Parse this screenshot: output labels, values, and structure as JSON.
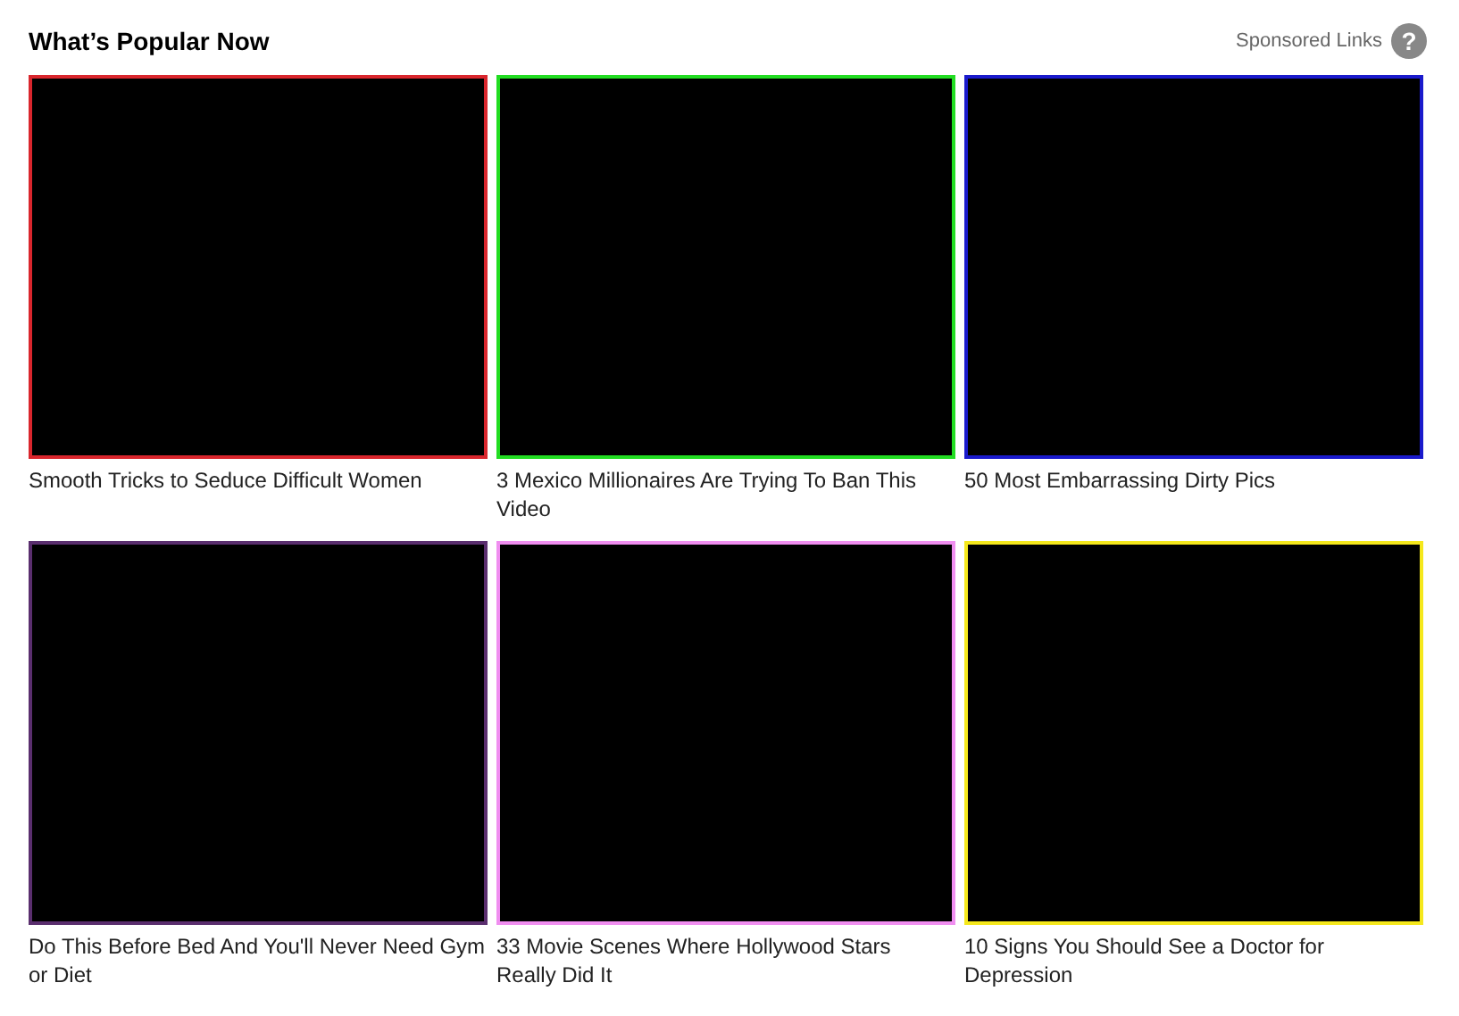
{
  "header": {
    "title": "What’s Popular Now",
    "sponsored_label": "Sponsored Links",
    "help_icon": "?"
  },
  "items": [
    {
      "caption": "Smooth Tricks to Seduce Difficult Women",
      "color": "#d9262d"
    },
    {
      "caption": "3 Mexico Millionaires Are Trying To Ban This Video",
      "color": "#22dd22"
    },
    {
      "caption": "50 Most Embarrassing Dirty Pics",
      "color": "#1a1acc"
    },
    {
      "caption": "Do This Before Bed And You'll Never Need Gym or Diet",
      "color": "#5a2e6e"
    },
    {
      "caption": "33 Movie Scenes Where Hollywood Stars Really Did It",
      "color": "#f08ef0"
    },
    {
      "caption": "10 Signs You Should See a Doctor for Depression",
      "color": "#f5e81c"
    }
  ]
}
